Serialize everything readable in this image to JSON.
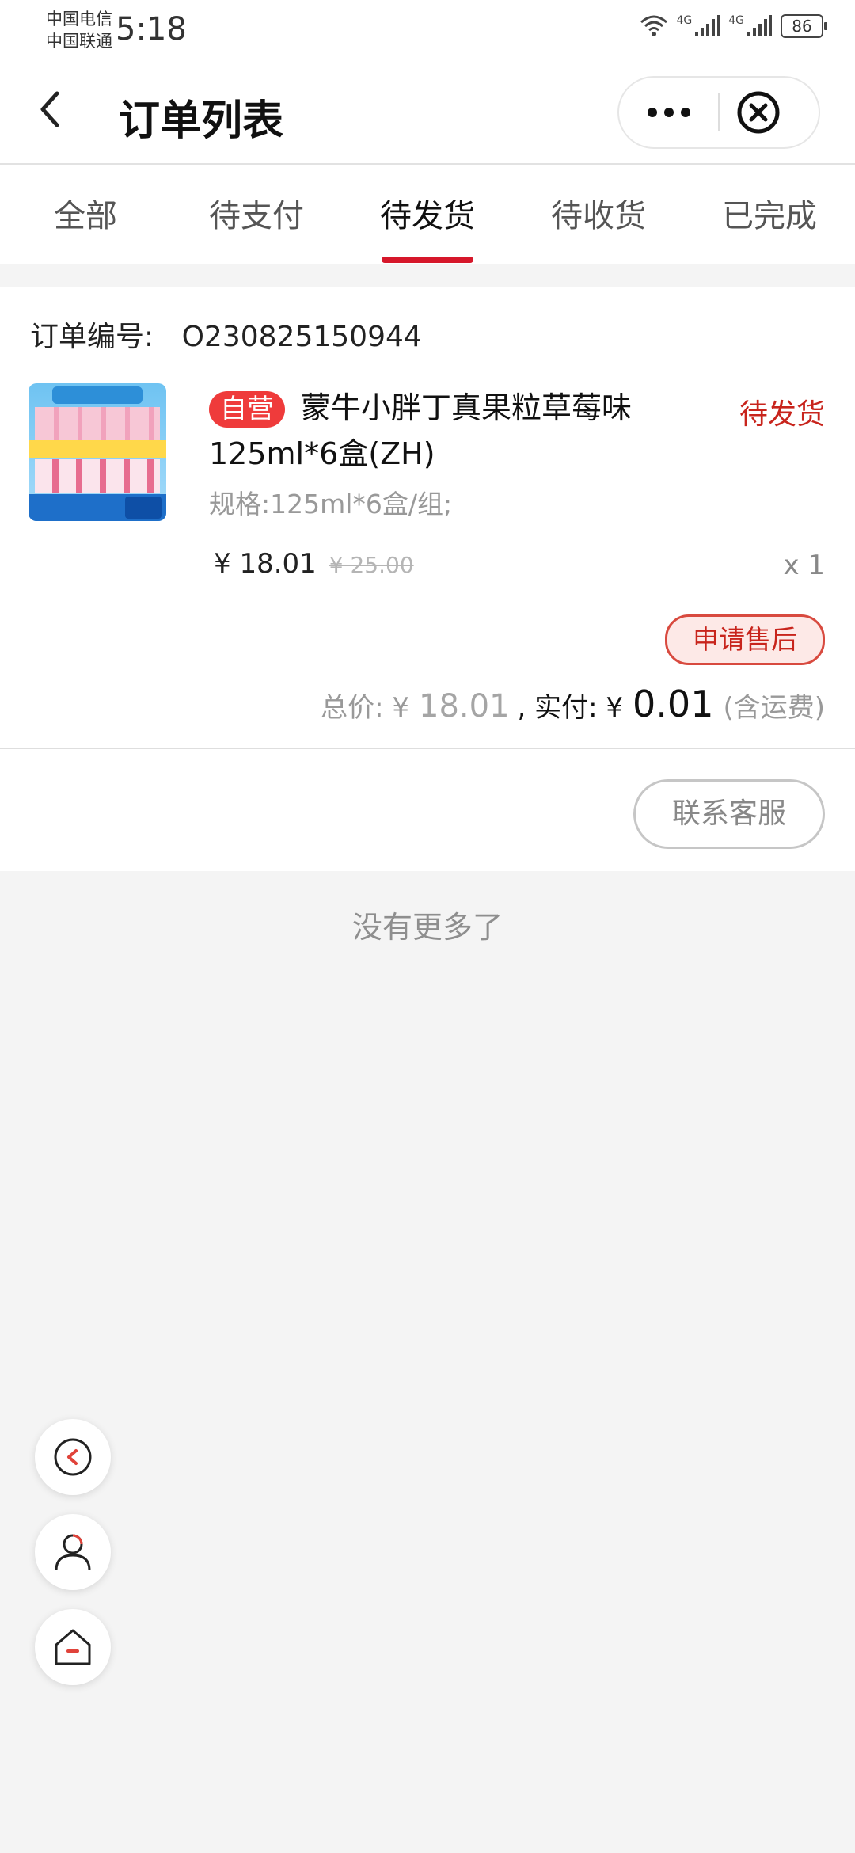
{
  "status_bar": {
    "carrier_1": "中国电信",
    "carrier_2": "中国联通",
    "time": "5:18",
    "network_1": "4G",
    "network_2": "4G",
    "battery": "86"
  },
  "navbar": {
    "title": "订单列表"
  },
  "tabs": [
    {
      "label": "全部"
    },
    {
      "label": "待支付"
    },
    {
      "label": "待发货"
    },
    {
      "label": "待收货"
    },
    {
      "label": "已完成"
    }
  ],
  "active_tab": "待发货",
  "order": {
    "number_label": "订单编号:",
    "number": "O230825150944",
    "tag": "自营",
    "product_name": "蒙牛小胖丁真果粒草莓味125ml*6盒(ZH)",
    "status": "待发货",
    "spec": "规格:125ml*6盒/组;",
    "price": "¥ 18.01",
    "original_price": "¥ 25.00",
    "quantity": "x 1",
    "after_sale_button": "申请售后",
    "total_label": "总价: ¥",
    "total_amount": "18.01",
    "paid_label": ", 实付: ¥",
    "paid_amount": "0.01",
    "shipping_note": "(含运费)",
    "contact_button": "联系客服"
  },
  "footer_text": "没有更多了",
  "colors": {
    "accent_red": "#d6172a",
    "status_red": "#c8241c",
    "tag_red": "#ef3b3b"
  },
  "icons": {
    "back": "chevron-left-icon",
    "more": "more-dots-icon",
    "close": "close-circle-icon",
    "fab_1": "back-circle-icon",
    "fab_2": "user-icon",
    "fab_3": "home-icon"
  }
}
